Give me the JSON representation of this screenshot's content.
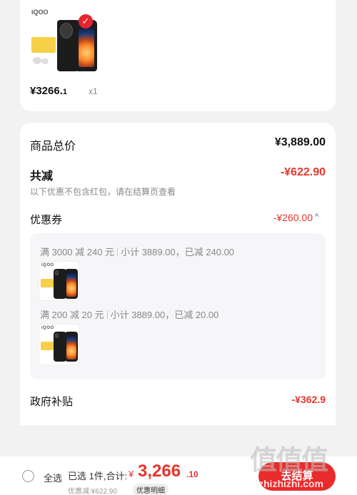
{
  "product": {
    "brand_logo": "iQOO",
    "price": "¥3266.",
    "price_cents": "1",
    "quantity": "x1",
    "selected_check": "✓"
  },
  "summary": {
    "subtotal_label": "商品总价",
    "subtotal_value": "¥3,889.00",
    "total_discount_label": "共减",
    "total_discount_value": "-¥622.90",
    "discount_note": "以下优惠不包含红包，请在结算页查看",
    "coupon_label": "优惠券",
    "coupon_value": "-¥260.00",
    "coupon_chevron": "^",
    "coupons": [
      {
        "rule": "满 3000 减 240 元",
        "detail": "小计 3889.00，已减 240.00"
      },
      {
        "rule": "满 200 减 20 元",
        "detail": "小计 3889.00，已减 20.00"
      }
    ],
    "subsidy_label": "政府补贴",
    "subsidy_value": "-¥362.9"
  },
  "bottom_bar": {
    "select_all_label": "全选",
    "selected_label": "已选 1件,合计:",
    "currency": "¥",
    "total_main": "3,266",
    "total_cents": ".10",
    "discount_summary": "优惠减:¥622.90",
    "detail_link": "优惠明细",
    "checkout_label": "去结算"
  },
  "watermark": {
    "logo_text": "值值值",
    "site": "zhizhizhi.com"
  },
  "colors": {
    "accent_red": "#e5352c",
    "badge_yellow": "#f6d048",
    "background": "#f2f2f2"
  }
}
